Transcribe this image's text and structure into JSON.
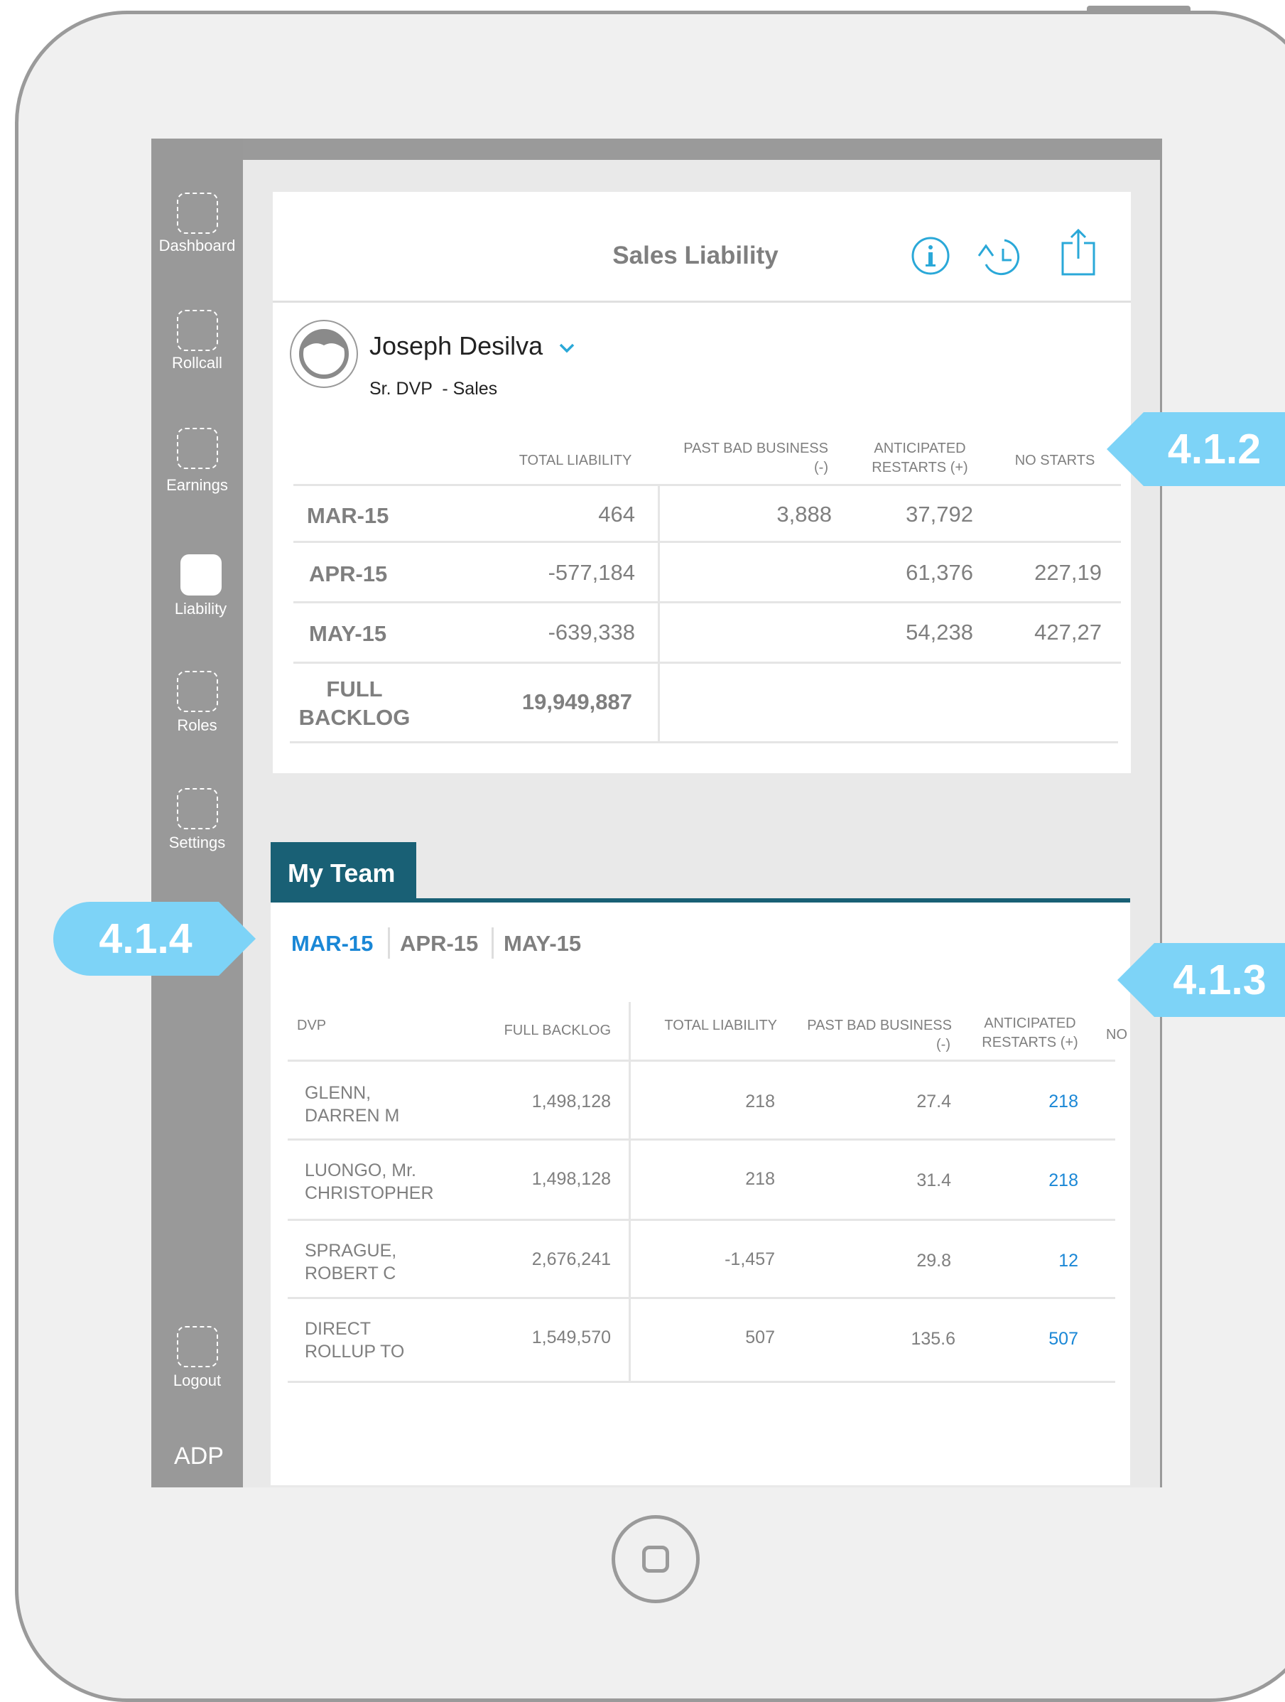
{
  "sidebar": {
    "items": [
      {
        "label": "Dashboard",
        "icon": "dashboard-icon"
      },
      {
        "label": "Rollcall",
        "icon": "rollcall-icon"
      },
      {
        "label": "Earnings",
        "icon": "earnings-icon"
      },
      {
        "label": "Liability",
        "icon": "liability-icon",
        "active": true
      },
      {
        "label": "Roles",
        "icon": "roles-icon"
      },
      {
        "label": "Settings",
        "icon": "settings-icon"
      },
      {
        "label": "Logout",
        "icon": "logout-icon"
      }
    ],
    "brand": "ADP"
  },
  "header": {
    "title": "Sales Liability",
    "icons": [
      "info-icon",
      "history-icon",
      "share-icon"
    ]
  },
  "user": {
    "name": "Joseph Desilva",
    "role": "Sr. DVP  - Sales"
  },
  "liability_table": {
    "columns": {
      "total_liability": "TOTAL LIABILITY",
      "past_bad_business_1": "PAST BAD BUSINESS",
      "past_bad_business_2": "(-)",
      "anticipated_1": "ANTICIPATED",
      "anticipated_2": "RESTARTS (+)",
      "no_starts": "NO STARTS"
    },
    "rows": [
      {
        "month": "MAR-15",
        "total": "464",
        "past_bad": "3,888",
        "anticipated": "37,792",
        "no_starts": ""
      },
      {
        "month": "APR-15",
        "total": "-577,184",
        "past_bad": "",
        "anticipated": "61,376",
        "no_starts": "227,19"
      },
      {
        "month": "MAY-15",
        "total": "-639,338",
        "past_bad": "",
        "anticipated": "54,238",
        "no_starts": "427,27"
      }
    ],
    "full_backlog": {
      "label_1": "FULL",
      "label_2": "BACKLOG",
      "value": "19,949,887"
    }
  },
  "team": {
    "tab_label": "My Team",
    "months": [
      "MAR-15",
      "APR-15",
      "MAY-15"
    ],
    "active_month": "MAR-15",
    "columns": {
      "dvp": "DVP",
      "full_backlog": "FULL BACKLOG",
      "total_liability": "TOTAL LIABILITY",
      "past_bad_1": "PAST BAD BUSINESS",
      "past_bad_2": "(-)",
      "anticipated_1": "ANTICIPATED",
      "anticipated_2": "RESTARTS (+)",
      "no": "NO"
    },
    "rows": [
      {
        "name_1": "GLENN,",
        "name_2": "DARREN M",
        "full_backlog": "1,498,128",
        "total_liability": "218",
        "past_bad": "27.4",
        "anticipated": "218"
      },
      {
        "name_1": "LUONGO, Mr.",
        "name_2": "CHRISTOPHER",
        "full_backlog": "1,498,128",
        "total_liability": "218",
        "past_bad": "31.4",
        "anticipated": "218"
      },
      {
        "name_1": "SPRAGUE,",
        "name_2": "ROBERT C",
        "full_backlog": "2,676,241",
        "total_liability": "-1,457",
        "past_bad": "29.8",
        "anticipated": "12"
      },
      {
        "name_1": "DIRECT",
        "name_2": "ROLLUP TO",
        "full_backlog": "1,549,570",
        "total_liability": "507",
        "past_bad": "135.6",
        "anticipated": "507"
      }
    ]
  },
  "annotations": {
    "callout_top": "4.1.2",
    "callout_team": "4.1.3",
    "callout_tabs": "4.1.4"
  },
  "colors": {
    "accent": "#2aa8d8",
    "link": "#1a87d6",
    "team_header": "#196075",
    "sidebar": "#999999",
    "callout": "#7dd3f7"
  }
}
